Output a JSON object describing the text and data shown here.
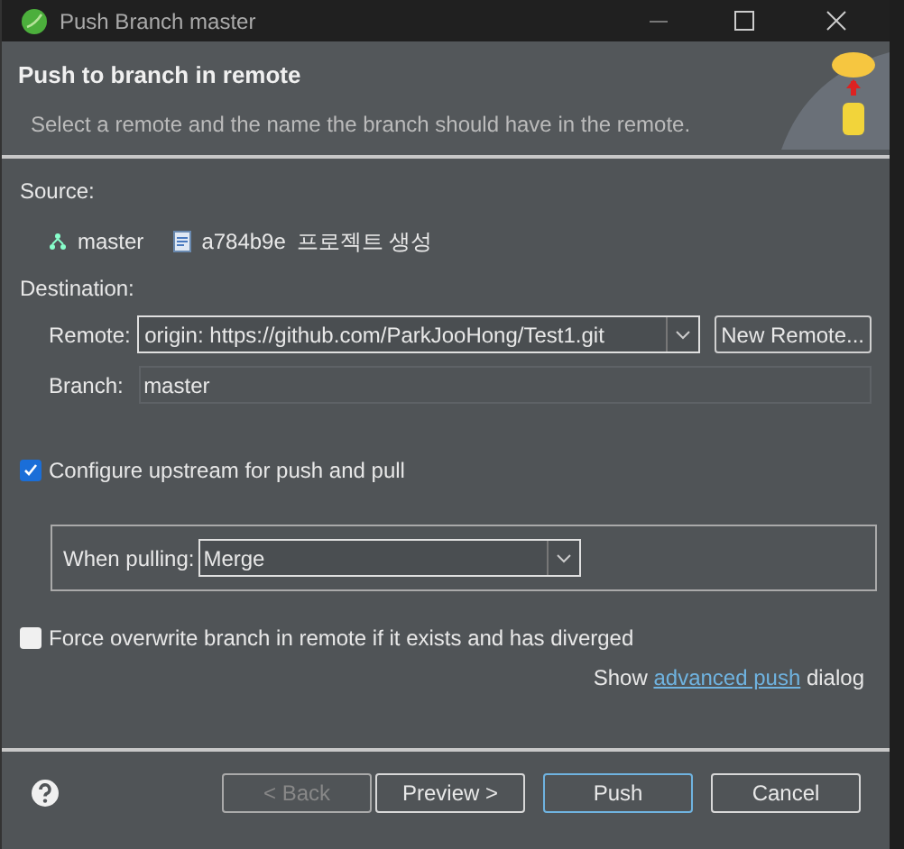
{
  "window": {
    "title": "Push Branch master"
  },
  "header": {
    "title": "Push to branch in remote",
    "description": "Select a remote and the name the branch should have in the remote."
  },
  "source": {
    "label": "Source:",
    "branch": "master",
    "commit_id": "a784b9e",
    "commit_message": "프로젝트 생성"
  },
  "destination": {
    "label": "Destination:",
    "remote_label": "Remote:",
    "remote_value": "origin: https://github.com/ParkJooHong/Test1.git",
    "new_remote_button": "New Remote...",
    "branch_label": "Branch:",
    "branch_value": "master"
  },
  "options": [
    {
      "label": "Configure upstream for push and pull",
      "checked": true
    }
  ],
  "pulling": {
    "label": "When pulling:",
    "value": "Merge"
  },
  "force": {
    "label": "Force overwrite branch in remote if it exists and has diverged",
    "checked": false
  },
  "advanced": {
    "before": "Show",
    "link": "advanced push",
    "after": "dialog"
  },
  "buttons": [
    {
      "label": "< Back",
      "disabled": true,
      "default": false
    },
    {
      "label": "Preview >",
      "disabled": false,
      "default": false
    },
    {
      "label": "Push",
      "disabled": false,
      "default": true
    },
    {
      "label": "Cancel",
      "disabled": false,
      "default": false
    }
  ]
}
